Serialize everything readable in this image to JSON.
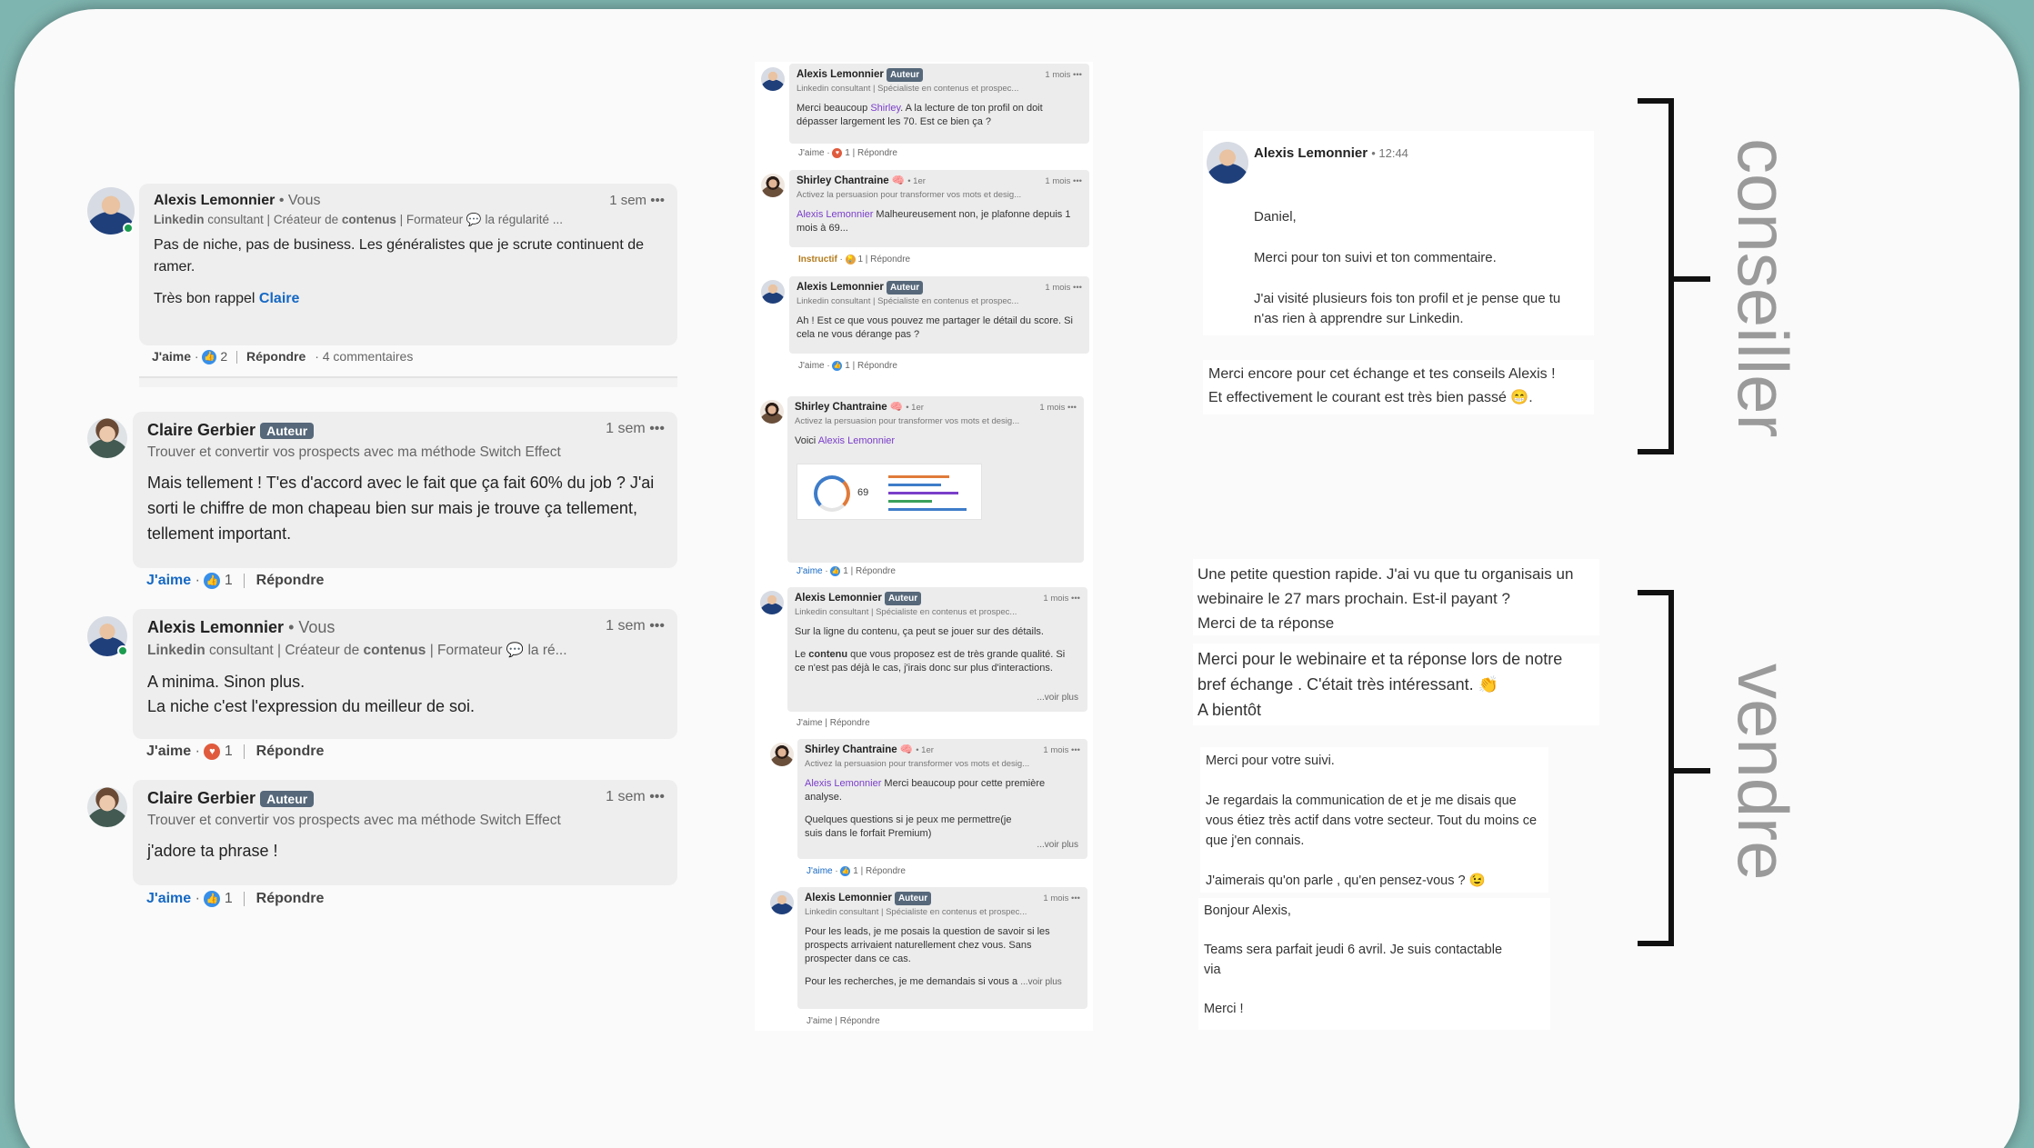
{
  "left": {
    "c1": {
      "name": "Alexis Lemonnier",
      "suffix": "• Vous",
      "time": "1 sem",
      "more": "•••",
      "sub_bold1": "Linkedin",
      "sub1": " consultant | Créateur de ",
      "sub_bold2": "contenus",
      "sub2": " | Formateur 💬 la régularité ...",
      "text1": "Pas de niche, pas de business. Les généralistes que je scrute continuent de ramer.",
      "text2": "Très bon rappel ",
      "mention": "Claire",
      "like": "J'aime",
      "count": "2",
      "reply": "Répondre",
      "comments": "4 commentaires"
    },
    "c2": {
      "name": "Claire Gerbier",
      "badge": "Auteur",
      "time": "1 sem",
      "more": "•••",
      "sub": "Trouver et convertir vos prospects avec ma méthode Switch Effect",
      "text": "Mais tellement ! T'es d'accord avec le fait que ça fait 60% du job ? J'ai sorti le chiffre de mon chapeau bien sur mais je trouve ça tellement, tellement important.",
      "like": "J'aime",
      "count": "1",
      "reply": "Répondre"
    },
    "c3": {
      "name": "Alexis Lemonnier",
      "suffix": "• Vous",
      "time": "1 sem",
      "more": "•••",
      "sub_bold1": "Linkedin",
      "sub1": " consultant | Créateur de ",
      "sub_bold2": "contenus",
      "sub2": " | Formateur 💬 la ré...",
      "text1": "A minima. Sinon plus.",
      "text2": "La niche c'est l'expression du meilleur de soi.",
      "like": "J'aime",
      "count": "1",
      "reply": "Répondre"
    },
    "c4": {
      "name": "Claire Gerbier",
      "badge": "Auteur",
      "time": "1 sem",
      "more": "•••",
      "sub": "Trouver et convertir vos prospects avec ma méthode Switch Effect",
      "text": "j'adore ta phrase !",
      "like": "J'aime",
      "count": "1",
      "reply": "Répondre"
    }
  },
  "middle": [
    {
      "name": "Alexis Lemonnier",
      "badge": "Auteur",
      "time": "1 mois •••",
      "sub": "Linkedin consultant | Spécialiste en contenus et prospec...",
      "text_pre": "Merci beaucoup ",
      "mention": "Shirley",
      "text": ". A la lecture de ton profil on doit dépasser largement les 70. Est ce bien ça ?",
      "like": "J'aime",
      "count": "1",
      "reply": "Répondre"
    },
    {
      "name": "Shirley Chantraine 🧠",
      "badge": "• 1er",
      "time": "1 mois •••",
      "sub": "Activez la persuasion pour transformer vos mots et desig...",
      "mention": "Alexis Lemonnier",
      "text": " Malheureusement non, je plafonne depuis 1 mois à 69...",
      "like": "Instructif",
      "count": "1",
      "reply": "Répondre"
    },
    {
      "name": "Alexis Lemonnier",
      "badge": "Auteur",
      "time": "1 mois •••",
      "sub": "Linkedin consultant | Spécialiste en contenus et prospec...",
      "text": "Ah ! Est ce que vous pouvez me partager le détail du score. Si cela ne vous dérange pas ?",
      "like": "J'aime",
      "count": "1",
      "reply": "Répondre"
    },
    {
      "name": "Shirley Chantraine 🧠",
      "badge": "• 1er",
      "time": "1 mois •••",
      "sub": "Activez la persuasion pour transformer vos mots et desig...",
      "text_pre": "Voici ",
      "mention": "Alexis Lemonnier",
      "score": "69",
      "like": "J'aime",
      "count": "1",
      "reply": "Répondre"
    },
    {
      "name": "Alexis Lemonnier",
      "badge": "Auteur",
      "time": "1 mois •••",
      "sub": "Linkedin consultant | Spécialiste en contenus et prospec...",
      "text": "Sur la ligne du contenu, ça peut se jouer sur des détails.",
      "text2_pre": "Le ",
      "text2_bold": "contenu",
      "text2": " que vous proposez est de très grande qualité. Si ce n'est pas déjà le cas, j'irais donc sur plus d'interactions.",
      "more": "...voir plus",
      "like": "J'aime",
      "reply": "Répondre"
    },
    {
      "name": "Shirley Chantraine 🧠",
      "badge": "• 1er",
      "time": "1 mois •••",
      "sub": "Activez la persuasion pour transformer vos mots et desig...",
      "mention": "Alexis Lemonnier",
      "text": " Merci beaucoup pour cette première analyse.",
      "text2": "Quelques questions si je peux me permettre(je suis dans le forfait Premium)",
      "more": "...voir plus",
      "like": "J'aime",
      "count": "1",
      "reply": "Répondre"
    },
    {
      "name": "Alexis Lemonnier",
      "badge": "Auteur",
      "time": "1 mois •••",
      "sub": "Linkedin consultant | Spécialiste en contenus et prospec...",
      "text": "Pour les leads, je me posais la question de savoir si les prospects arrivaient naturellement chez vous. Sans prospecter dans ce cas.",
      "text2": "Pour les recherches, je me demandais si vous a",
      "more": "...voir plus",
      "like": "J'aime",
      "reply": "Répondre"
    }
  ],
  "right": {
    "msg1": {
      "name": "Alexis Lemonnier",
      "time": "• 12:44",
      "l1": "Daniel,",
      "l2": "Merci pour ton suivi et ton commentaire.",
      "l3": "J'ai visité plusieurs fois ton profil et je pense que tu n'as rien à apprendre sur Linkedin."
    },
    "msg2": {
      "l1": "Merci encore pour cet échange et tes conseils Alexis !",
      "l2": "Et effectivement le courant est très bien passé 😁."
    },
    "msg3": {
      "l1": "Une petite question rapide. J'ai vu que tu organisais un webinaire le 27 mars prochain. Est-il payant  ?",
      "l2": "Merci de ta réponse"
    },
    "msg4": {
      "l1": "Merci pour le webinaire et ta réponse lors de notre bref échange . C'était très intéressant. 👏",
      "l2": "A bientôt"
    },
    "msg5": {
      "l1": "Merci pour votre suivi.",
      "l2": "Je regardais la communication de           et je me disais que vous étiez très actif dans votre secteur. Tout du moins ce que j'en connais.",
      "l3": "J'aimerais qu'on parle          , qu'en pensez-vous ? 😉"
    },
    "msg6": {
      "l1": "Bonjour Alexis,",
      "l2": "Teams sera parfait jeudi 6 avril. Je suis contactable via",
      "l3": "Merci !"
    }
  },
  "labels": {
    "top": "conseiller",
    "bottom": "vendre"
  }
}
